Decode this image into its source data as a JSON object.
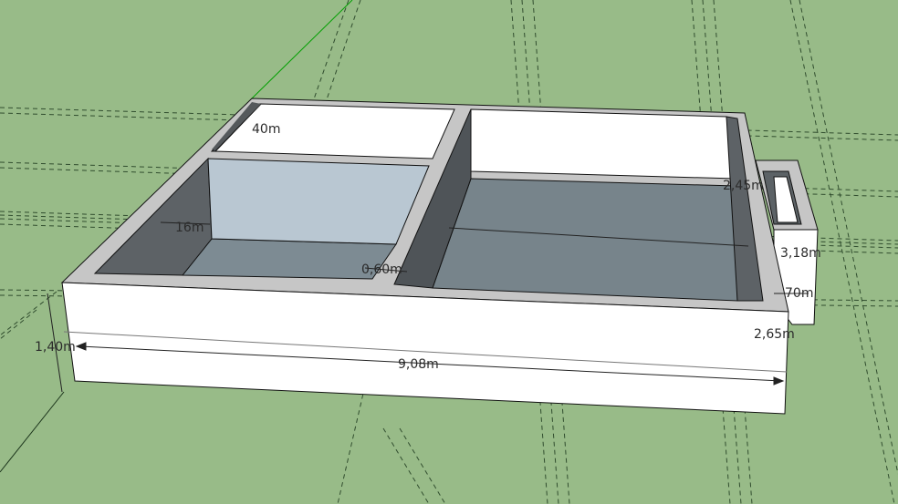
{
  "viewport": {
    "ground_color": "#98bb88",
    "axis_color": "#00a000",
    "guide_color": "#1d3a1d",
    "wall_top_color": "#c6c6c6",
    "wall_face_color": "#ffffff",
    "floor_color": "#7d8b93",
    "inner_wall_color": "#4f5458",
    "glass_color": "#b9c7d2"
  },
  "dimensions": {
    "top_left_room": "40m",
    "left_room": "16m",
    "partition": "0,60m",
    "right_room": "2,45m",
    "annex_depth": "3,18m",
    "annex_small": "70m",
    "height_left": "1,40m",
    "total_length": "9,08m",
    "height_right": "2,65m"
  }
}
